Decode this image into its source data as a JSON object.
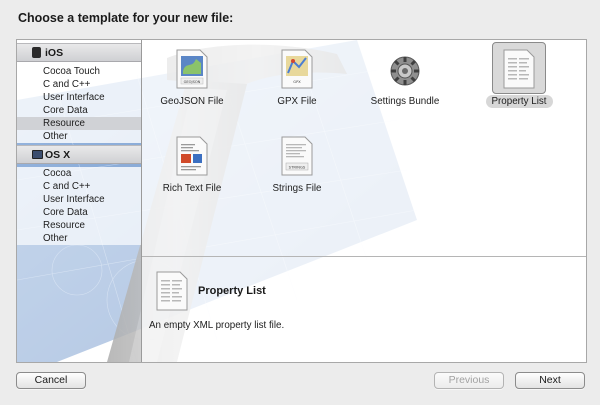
{
  "dialog": {
    "title": "Choose a template for your new file:"
  },
  "sidebar": {
    "groups": [
      {
        "label": "iOS",
        "icon": "iphone-icon",
        "items": [
          "Cocoa Touch",
          "C and C++",
          "User Interface",
          "Core Data",
          "Resource",
          "Other"
        ]
      },
      {
        "label": "OS X",
        "icon": "mac-icon",
        "items": [
          "Cocoa",
          "C and C++",
          "User Interface",
          "Core Data",
          "Resource",
          "Other"
        ]
      }
    ],
    "selected": "Resource"
  },
  "templates": [
    {
      "label": "GeoJSON File",
      "icon": "geojson-file-icon",
      "badge": "GEOJSON"
    },
    {
      "label": "GPX File",
      "icon": "gpx-file-icon",
      "badge": "GPX"
    },
    {
      "label": "Settings Bundle",
      "icon": "settings-bundle-icon"
    },
    {
      "label": "Property List",
      "icon": "property-list-icon",
      "selected": true
    },
    {
      "label": "Rich Text File",
      "icon": "rich-text-file-icon"
    },
    {
      "label": "Strings File",
      "icon": "strings-file-icon",
      "badge": "STRINGS"
    }
  ],
  "detail": {
    "title": "Property List",
    "description": "An empty XML property list file.",
    "icon": "property-list-icon"
  },
  "buttons": {
    "cancel": "Cancel",
    "previous": "Previous",
    "next": "Next"
  },
  "colors": {
    "sidebar_selection": "#d0d2d6",
    "blueprint": "#6d93c9",
    "window_bg": "#ececec"
  }
}
